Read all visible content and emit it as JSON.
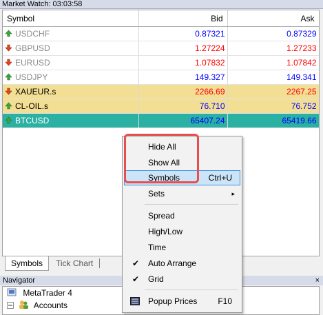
{
  "window": {
    "title": "Market Watch: 03:03:58"
  },
  "columns": {
    "symbol": "Symbol",
    "bid": "Bid",
    "ask": "Ask"
  },
  "rows": [
    {
      "symbol": "USDCHF",
      "bid": "0.87321",
      "ask": "0.87329",
      "direction": "up",
      "style": "dim"
    },
    {
      "symbol": "GBPUSD",
      "bid": "1.27224",
      "ask": "1.27233",
      "direction": "down",
      "style": "dim"
    },
    {
      "symbol": "EURUSD",
      "bid": "1.07832",
      "ask": "1.07842",
      "direction": "down",
      "style": "dim"
    },
    {
      "symbol": "USDJPY",
      "bid": "149.327",
      "ask": "149.341",
      "direction": "up",
      "style": "dim"
    },
    {
      "symbol": "XAUEUR.s",
      "bid": "2266.69",
      "ask": "2267.25",
      "direction": "down",
      "style": "gold"
    },
    {
      "symbol": "CL-OIL.s",
      "bid": "76.710",
      "ask": "76.752",
      "direction": "up",
      "style": "gold"
    },
    {
      "symbol": "BTCUSD",
      "bid": "65407.24",
      "ask": "65419.66",
      "direction": "up",
      "style": "teal"
    }
  ],
  "tabs": {
    "symbols": "Symbols",
    "tick_chart": "Tick Chart"
  },
  "navigator": {
    "title": "Navigator",
    "close": "×",
    "items": {
      "metatrader": "MetaTrader 4",
      "accounts": "Accounts"
    }
  },
  "context_menu": {
    "hide_all": "Hide All",
    "show_all": "Show All",
    "symbols": "Symbols",
    "symbols_shortcut": "Ctrl+U",
    "sets": "Sets",
    "spread": "Spread",
    "high_low": "High/Low",
    "time": "Time",
    "auto_arrange": "Auto Arrange",
    "auto_arrange_checked": true,
    "grid": "Grid",
    "grid_checked": true,
    "popup_prices": "Popup Prices",
    "popup_prices_shortcut": "F10",
    "check_mark": "✔",
    "submenu_arrow": "▸"
  },
  "colors": {
    "up_arrow": "#3aa63a",
    "down_arrow": "#e0461f",
    "gold_row": "#f2df94",
    "teal_row": "#2bb1a4",
    "bid_up": "#0000ff",
    "bid_down": "#ff0000",
    "highlight": "#cce4f7",
    "annotation_box": "#e74f4f"
  }
}
